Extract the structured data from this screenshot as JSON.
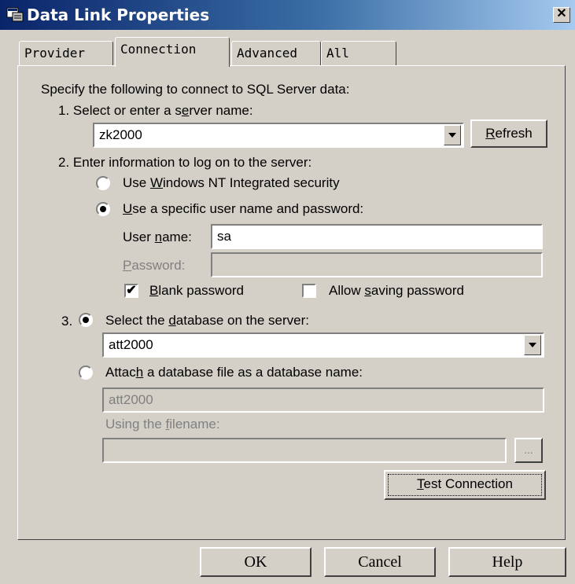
{
  "window": {
    "title": "Data Link Properties",
    "close_label": "✕"
  },
  "tabs": [
    {
      "label": "Provider"
    },
    {
      "label": "Connection"
    },
    {
      "label": "Advanced"
    },
    {
      "label": "All"
    }
  ],
  "intro": "Specify the following to connect to SQL Server data:",
  "step1": {
    "label_pre": "1. Select or enter a s",
    "label_u": "e",
    "label_post": "rver name:",
    "server_value": "zk2000",
    "refresh_u": "R",
    "refresh_rest": "efresh"
  },
  "step2": {
    "label": "2. Enter information to log on to the server:",
    "radio_nt": {
      "pre": "Use ",
      "u": "W",
      "post": "indows NT Integrated security",
      "selected": false
    },
    "radio_specific": {
      "pre": "",
      "u": "U",
      "post": "se a specific user name and password:",
      "selected": true
    },
    "username_label_pre": "User ",
    "username_label_u": "n",
    "username_label_post": "ame:",
    "username_value": "sa",
    "password_label_u": "P",
    "password_label_post": "assword:",
    "password_value": "",
    "blank_password": {
      "u": "B",
      "post": "lank password",
      "checked": true
    },
    "allow_saving": {
      "pre": "Allow ",
      "u": "s",
      "post": "aving password",
      "checked": false
    }
  },
  "step3": {
    "number": "3.",
    "radio_select_db": {
      "pre": "Select the ",
      "u": "d",
      "post": "atabase on the server:",
      "selected": true
    },
    "database_value": "att2000",
    "radio_attach": {
      "pre": "Attac",
      "u": "h",
      "post": " a database file as a database name:",
      "selected": false
    },
    "attach_value": "att2000",
    "filename_label_pre": "Using the ",
    "filename_label_u": "f",
    "filename_label_post": "ilename:",
    "filename_value": "",
    "browse_label": "...",
    "test_u": "T",
    "test_rest": "est Connection"
  },
  "footer": {
    "ok": "OK",
    "cancel": "Cancel",
    "help": "Help"
  }
}
